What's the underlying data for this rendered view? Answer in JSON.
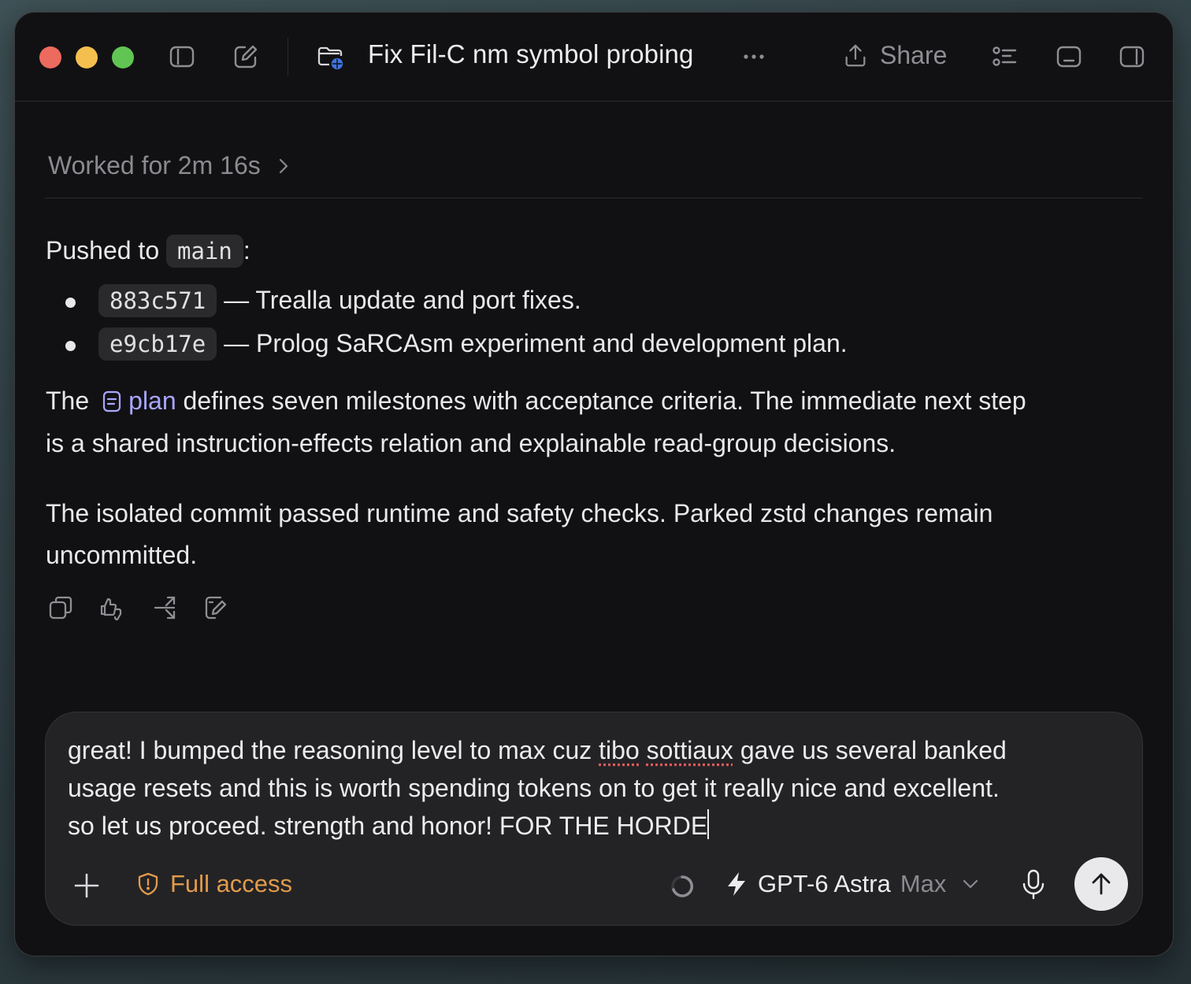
{
  "window": {
    "title": "Fix Fil-C nm symbol probing",
    "share_label": "Share",
    "icons": [
      "sidebar-toggle-icon",
      "compose-icon",
      "folder-globe-icon",
      "more-icon",
      "share-icon",
      "checklist-icon",
      "bottom-panel-icon",
      "right-panel-icon"
    ]
  },
  "conversation": {
    "worked_label": "Worked for 2m 16s",
    "pushed_prefix": "Pushed to",
    "pushed_branch": "main",
    "pushed_suffix": ":",
    "commits": [
      {
        "hash": "883c571",
        "desc": "— Trealla update and port fixes."
      },
      {
        "hash": "e9cb17e",
        "desc": "— Prolog SaRCAsm experiment and development plan."
      }
    ],
    "para1_prefix": "The",
    "plan_link": "plan",
    "para1_line1_rest": "defines seven milestones with acceptance criteria. The immediate next step",
    "para1_line2": "is a shared instruction-effects relation and explainable read-group decisions.",
    "para2_line1": "The isolated commit passed runtime and safety checks. Parked zstd changes remain",
    "para2_line2": "uncommitted.",
    "action_icons": [
      "copy-icon",
      "feedback-icon",
      "fork-icon",
      "edit-icon"
    ]
  },
  "composer": {
    "line1_a": "great! I bumped the reasoning level to max cuz ",
    "line1_misspelled_1": "tibo",
    "line1_space": " ",
    "line1_misspelled_2": "sottiaux",
    "line1_b": " gave us several banked",
    "line2": "usage resets and this is worth spending tokens on to get it really nice and excellent.",
    "line3": "so let us proceed. strength and honor! FOR THE HORDE",
    "access_label": "Full access",
    "model_name": "GPT-6 Astra",
    "model_level": "Max",
    "accent_color": "#e39b4a"
  }
}
